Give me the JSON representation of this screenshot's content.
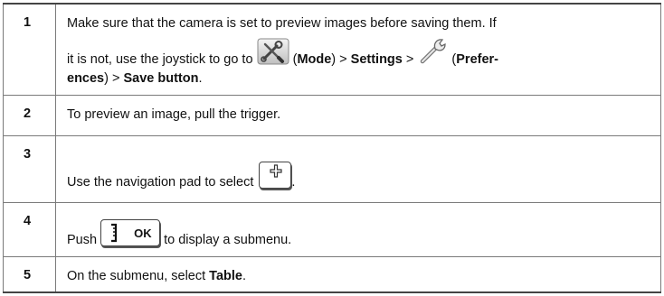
{
  "steps": [
    {
      "number": "1",
      "line1": "Make sure that the camera is set to preview images before saving them. If",
      "line2_pre": "it is not, use the joystick to go to",
      "mode_paren_open": " (",
      "mode_label": "Mode",
      "mode_paren_close": ") > ",
      "settings_label": "Settings",
      "settings_sep": " > ",
      "pref_paren_open": " (",
      "pref_label_part1": "Prefer-",
      "pref_label_part2": "ences",
      "pref_paren_close": ") > ",
      "save_label": "Save button",
      "end": ".",
      "icons": [
        "mode-tools-icon",
        "preferences-wrench-icon"
      ]
    },
    {
      "number": "2",
      "text": "To preview an image, pull the trigger."
    },
    {
      "number": "3",
      "text_pre": "Use the navigation pad to select",
      "text_post": ".",
      "icons": [
        "plus-button-icon"
      ]
    },
    {
      "number": "4",
      "text_pre": "Push",
      "button_label": "OK",
      "text_post": "to display a submenu.",
      "icons": [
        "ok-button-icon"
      ]
    },
    {
      "number": "5",
      "text_pre": "On the submenu, select ",
      "table_label": "Table",
      "text_post": "."
    }
  ]
}
